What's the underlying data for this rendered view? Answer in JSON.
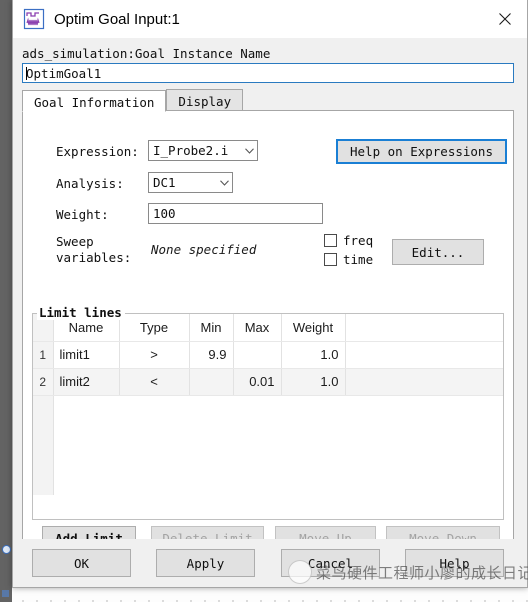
{
  "window": {
    "title": "Optim Goal Input:1",
    "icon": "waveform-icon",
    "close_label": "✕"
  },
  "instance": {
    "label": "ads_simulation:Goal Instance Name",
    "value": "OptimGoal1"
  },
  "tabs": [
    {
      "label": "Goal Information",
      "active": true
    },
    {
      "label": "Display",
      "active": false
    }
  ],
  "goal_information": {
    "expression": {
      "label": "Expression:",
      "value": "I_Probe2.i"
    },
    "analysis": {
      "label": "Analysis:",
      "value": "DC1"
    },
    "weight": {
      "label": "Weight:",
      "value": "100"
    },
    "sweep": {
      "label_line1": "Sweep",
      "label_line2": "variables:",
      "value": "None specified",
      "checkboxes": [
        {
          "label": "freq",
          "checked": false
        },
        {
          "label": "time",
          "checked": false
        }
      ],
      "edit_button": "Edit..."
    },
    "help_button": "Help on Expressions"
  },
  "limit_lines": {
    "group_title": "Limit lines",
    "columns": [
      "",
      "Name",
      "Type",
      "Min",
      "Max",
      "Weight",
      ""
    ],
    "rows": [
      {
        "index": "1",
        "name": "limit1",
        "type": ">",
        "min": "9.9",
        "max": "",
        "weight": "1.0"
      },
      {
        "index": "2",
        "name": "limit2",
        "type": "<",
        "min": "",
        "max": "0.01",
        "weight": "1.0"
      }
    ],
    "buttons": [
      {
        "label": "Add Limit",
        "enabled": true
      },
      {
        "label": "Delete Limit",
        "enabled": false
      },
      {
        "label": "Move Up",
        "enabled": false
      },
      {
        "label": "Move Down",
        "enabled": false
      }
    ]
  },
  "footer_buttons": [
    {
      "label": "OK"
    },
    {
      "label": "Apply"
    },
    {
      "label": "Cancel"
    },
    {
      "label": "Help"
    }
  ],
  "watermark": {
    "text": "菜鸟硬件工程师小廖的成长日记"
  },
  "colors": {
    "focus_blue": "#1a7fd4",
    "dialog_bg": "#f0f0f0",
    "panel_white": "#ffffff",
    "wire_blue": "#1b1bc8"
  }
}
